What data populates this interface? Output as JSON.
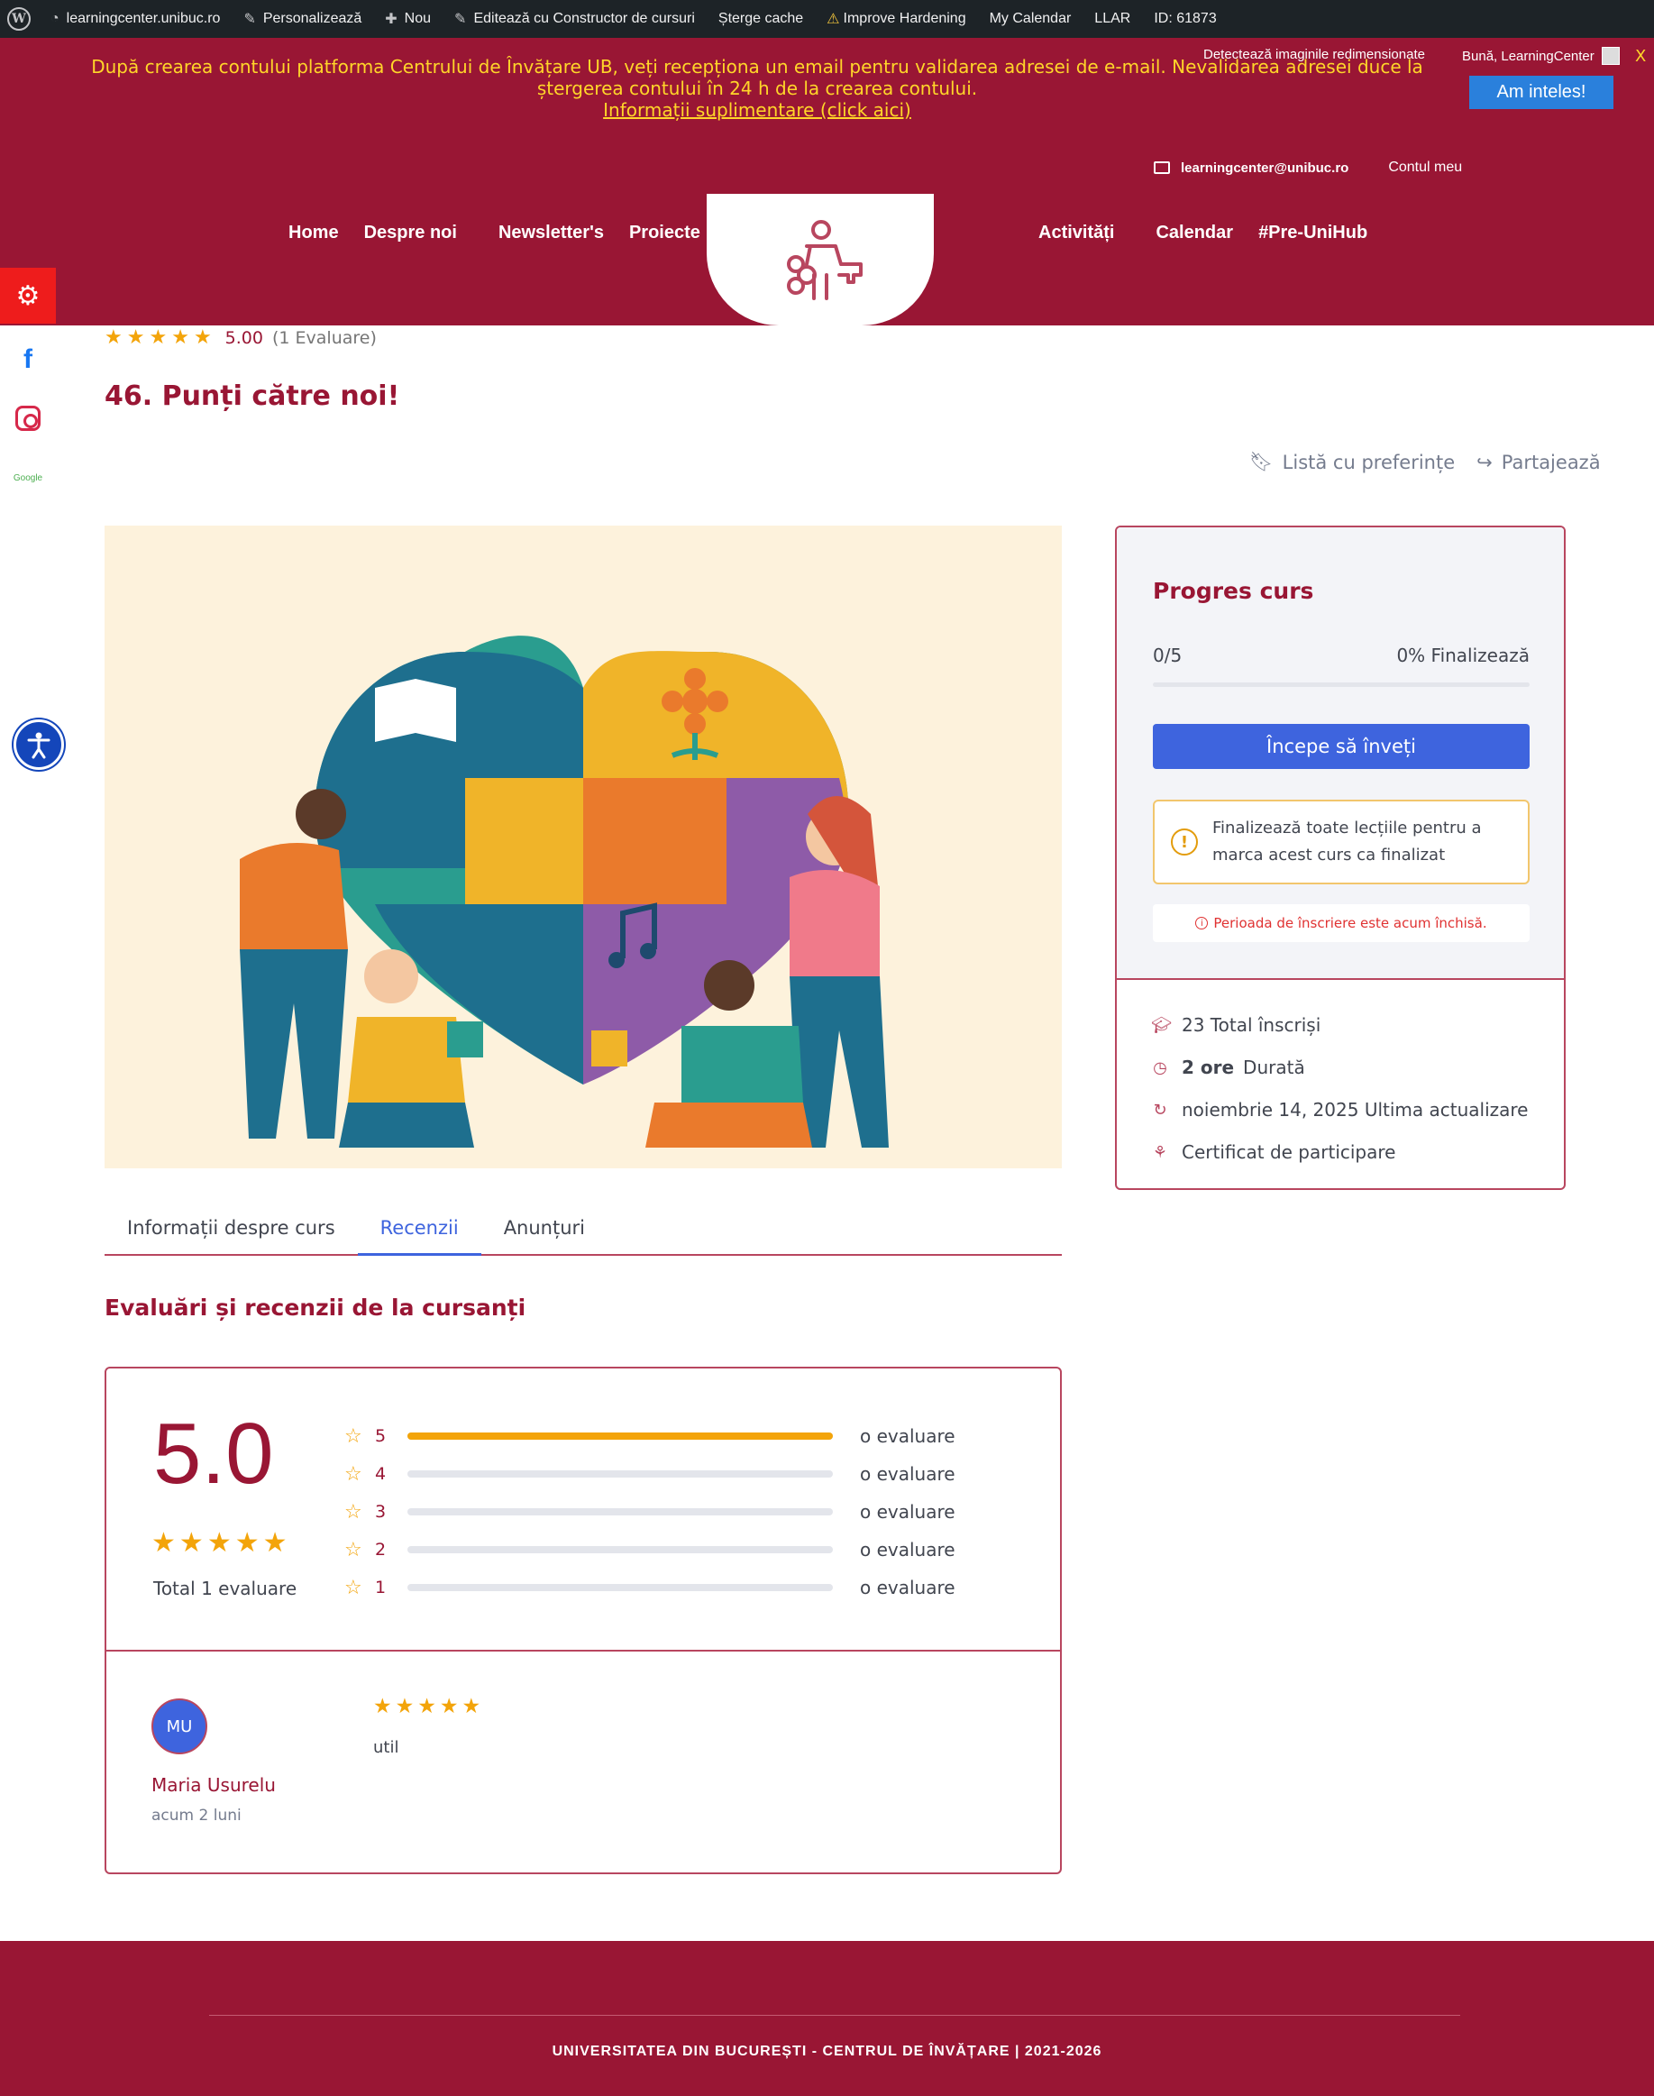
{
  "adminbar": {
    "site": "learningcenter.unibuc.ro",
    "customize": "Personalizează",
    "new": "Nou",
    "edit_builder": "Editează cu Constructor de cursuri",
    "clear_cache": "Șterge cache",
    "hardening": "Improve Hardening",
    "calendar": "My Calendar",
    "llar": "LLAR",
    "id": "ID: 61873"
  },
  "notice": {
    "line1": "După crearea contului platforma Centrului de Învățare UB, veți recepționa un email pentru validarea adresei de e-mail. Nevalidarea adresei duce la",
    "line2": "ștergerea contului în 24 h de la crearea contului.",
    "link": "Informații suplimentare (click aici)",
    "detect": "Detectează imaginile redimensionate",
    "hello": "Bună, LearningCenter",
    "close": "X",
    "ok_button": "Am inteles!"
  },
  "header": {
    "email": "learningcenter@unibuc.ro",
    "account": "Contul meu",
    "nav_left": [
      "Home",
      "Despre noi",
      "Newsletter's",
      "Proiecte"
    ],
    "nav_right": [
      "Activități",
      "Calendar",
      "#Pre-UniHub"
    ]
  },
  "social": {
    "fb": "f",
    "google": "Google"
  },
  "course": {
    "rating_value": "5.00",
    "rating_count": "(1 Evaluare)",
    "rating_stars": 5,
    "title": "46. Punți către noi!",
    "wishlist": "Listă cu preferințe",
    "share": "Partajează"
  },
  "tabs": [
    "Informații despre curs",
    "Recenzii",
    "Anunțuri"
  ],
  "reviews": {
    "heading": "Evaluări și recenzii de la cursanți",
    "score": "5.0",
    "total": "Total 1 evaluare",
    "bars": [
      {
        "star": "5",
        "label": "o evaluare",
        "fraction": 1.0
      },
      {
        "star": "4",
        "label": "o evaluare",
        "fraction": 0
      },
      {
        "star": "3",
        "label": "o evaluare",
        "fraction": 0
      },
      {
        "star": "2",
        "label": "o evaluare",
        "fraction": 0
      },
      {
        "star": "1",
        "label": "o evaluare",
        "fraction": 0
      }
    ],
    "items": [
      {
        "initials": "MU",
        "name": "Maria Usurelu",
        "time": "acum 2 luni",
        "stars": 5,
        "text": "util"
      }
    ]
  },
  "sidebar": {
    "title": "Progres curs",
    "progress_count": "0/5",
    "progress_pct": "0% Finalizează",
    "progress_fraction": 0,
    "start_button": "Începe să înveți",
    "warning": "Finalizează toate lecțiile pentru a marca acest curs ca finalizat",
    "closed": "Perioada de înscriere este acum închisă.",
    "enrolled": "23 Total înscriși",
    "duration_value": "2 ore",
    "duration_label": "Durată",
    "updated": "noiembrie 14, 2025 Ultima actualizare",
    "certificate": "Certificat de participare"
  },
  "footer": {
    "text": "UNIVERSITATEA DIN BUCUREȘTI - CENTRUL DE ÎNVĂȚARE | 2021-2026"
  },
  "colors": {
    "brand": "#991634",
    "accent": "#3e64de",
    "star": "#f3a40a",
    "notice": "#ffd629"
  }
}
